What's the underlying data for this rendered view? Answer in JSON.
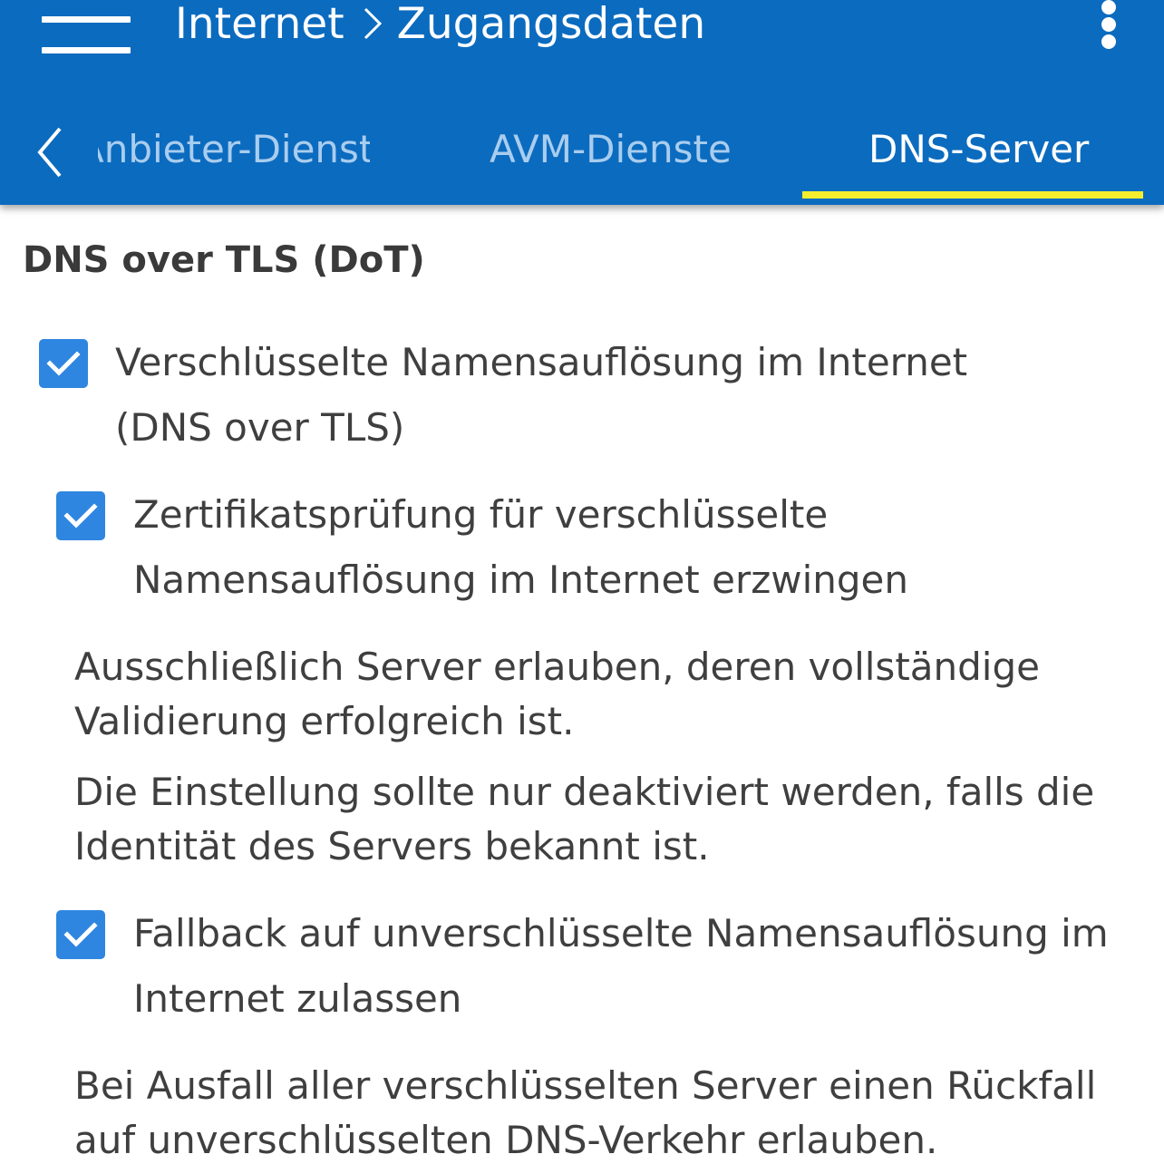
{
  "header": {
    "title_section": "Internet",
    "title_page": "Zugangsdaten",
    "menu_icon": "hamburger-menu-icon",
    "overflow_icon": "more-vertical-icon",
    "color": "#0b6bbf"
  },
  "tabs": {
    "back_icon": "chevron-left-icon",
    "items": [
      {
        "label": "Anbieter-Dienste"
      },
      {
        "label": "AVM-Dienste"
      },
      {
        "label": "DNS-Server",
        "active": true
      }
    ],
    "active_indicator_color": "#f4ee2e"
  },
  "content": {
    "section_title": "DNS over TLS (DoT)",
    "options": [
      {
        "checked": true,
        "label": "Verschlüsselte Namensauflösung im Internet (DNS over TLS)"
      },
      {
        "checked": true,
        "label": "Zertifikatsprüfung für verschlüsselte Namensauflösung im Internet erzwingen",
        "descriptions": [
          "Ausschließlich Server erlauben, deren vollständige Validierung erfolgreich ist.",
          "Die Einstellung sollte nur deaktiviert werden, falls die Identität des Servers bekannt ist."
        ]
      },
      {
        "checked": true,
        "label": "Fallback auf unverschlüsselte Namensauflösung im Internet zulassen",
        "descriptions": [
          "Bei Ausfall aller verschlüsselten Server einen Rückfall auf unverschlüsselten DNS-Verkehr erlauben."
        ]
      }
    ],
    "checkbox_color": "#2e86e0"
  }
}
